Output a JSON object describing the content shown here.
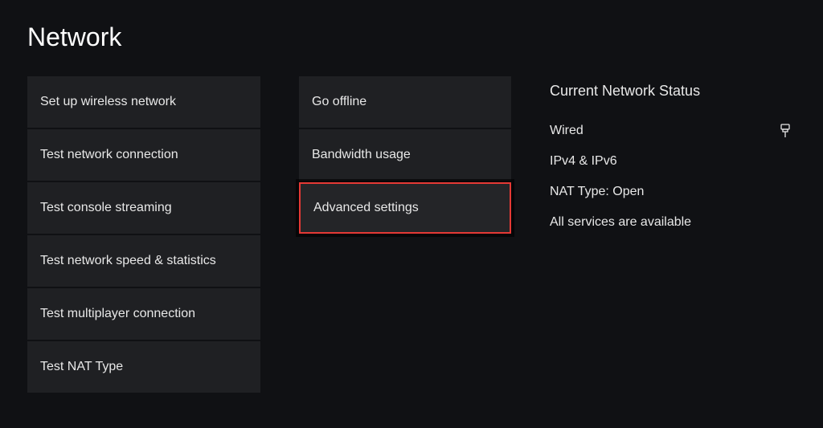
{
  "title": "Network",
  "column1": [
    "Set up wireless network",
    "Test network connection",
    "Test console streaming",
    "Test network speed & statistics",
    "Test multiplayer connection",
    "Test NAT Type"
  ],
  "column2": [
    "Go offline",
    "Bandwidth usage",
    "Advanced settings"
  ],
  "highlighted_index": 2,
  "status": {
    "heading": "Current Network Status",
    "connection_type": "Wired",
    "ip_version": "IPv4 & IPv6",
    "nat_type": "NAT Type: Open",
    "services": "All services are available"
  }
}
